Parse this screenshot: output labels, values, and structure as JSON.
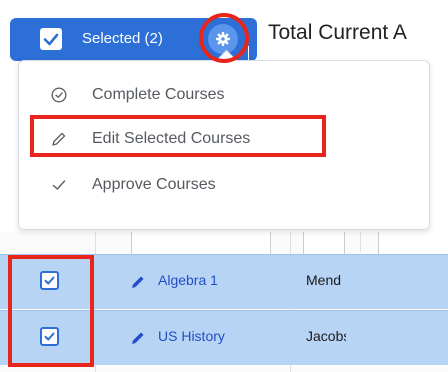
{
  "toolbar": {
    "selected_label": "Selected (2)",
    "title": "Total Current A"
  },
  "menu": {
    "items": [
      {
        "label": "Complete Courses",
        "icon": "check-circle-icon"
      },
      {
        "label": "Edit Selected Courses",
        "icon": "pencil-icon"
      },
      {
        "label": "Approve Courses",
        "icon": "check-icon"
      }
    ]
  },
  "table": {
    "rows": [
      {
        "course": "Algebra 1",
        "teacher": "Mend",
        "checked": true
      },
      {
        "course": "US History",
        "teacher": "Jacobs",
        "checked": true
      }
    ]
  },
  "colors": {
    "primary": "#2c6fd6",
    "row_selected": "#b8d4f5",
    "annotation": "#e8241b"
  }
}
